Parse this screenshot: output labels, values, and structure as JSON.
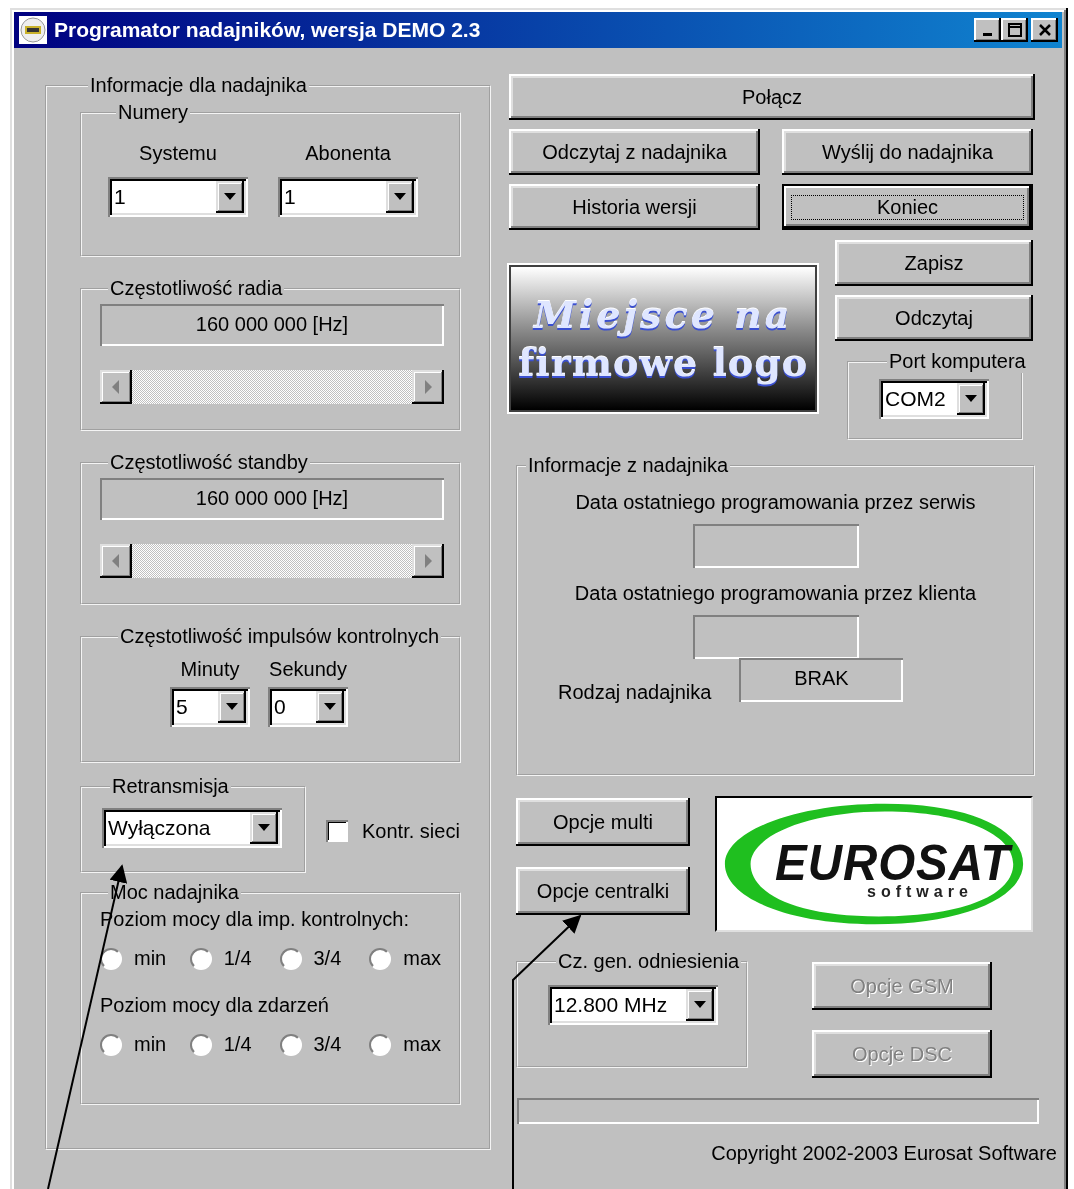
{
  "window": {
    "title": "Programator nadajników, wersja DEMO 2.3"
  },
  "transmitter_info": {
    "title": "Informacje dla nadajnika",
    "numbers": {
      "title": "Numery",
      "fields": [
        {
          "label": "Systemu",
          "value": "1"
        },
        {
          "label": "Abonenta",
          "value": "1"
        }
      ]
    },
    "radio_frequency": {
      "title": "Częstotliwość radia",
      "value": "160 000 000 [Hz]"
    },
    "standby_frequency": {
      "title": "Częstotliwość standby",
      "value": "160 000 000 [Hz]"
    },
    "control_pulses": {
      "title": "Częstotliwość impulsów kontrolnych",
      "fields": [
        {
          "label": "Minuty",
          "value": "5"
        },
        {
          "label": "Sekundy",
          "value": "0"
        }
      ]
    },
    "retransmission": {
      "title": "Retransmisja",
      "value": "Wyłączona"
    },
    "network_control": {
      "label": "Kontr. sieci",
      "checked": false
    },
    "power": {
      "title": "Moc nadajnika",
      "groups": [
        {
          "label": "Poziom mocy dla imp. kontrolnych:",
          "options": [
            {
              "label": "min",
              "selected": false
            },
            {
              "label": "1/4",
              "selected": false
            },
            {
              "label": "3/4",
              "selected": false
            },
            {
              "label": "max",
              "selected": false
            }
          ]
        },
        {
          "label": "Poziom mocy dla zdarzeń",
          "options": [
            {
              "label": "min",
              "selected": false
            },
            {
              "label": "1/4",
              "selected": false
            },
            {
              "label": "3/4",
              "selected": false
            },
            {
              "label": "max",
              "selected": false
            }
          ]
        }
      ]
    }
  },
  "top_buttons": [
    [
      {
        "label": "Połącz",
        "disabled": false,
        "focused": false
      }
    ],
    [
      {
        "label": "Odczytaj z nadajnika",
        "disabled": false,
        "focused": false
      },
      {
        "label": "Wyślij do nadajnika",
        "disabled": false,
        "focused": false
      }
    ],
    [
      {
        "label": "Historia wersji",
        "disabled": false,
        "focused": false
      },
      {
        "label": "Koniec",
        "disabled": false,
        "focused": true
      }
    ]
  ],
  "logo_placeholder": {
    "lines": [
      "Miejsce na",
      "firmowe logo"
    ]
  },
  "file_buttons": [
    {
      "label": "Zapisz",
      "disabled": false,
      "focused": false
    },
    {
      "label": "Odczytaj",
      "disabled": false,
      "focused": false
    }
  ],
  "port": {
    "title": "Port komputera",
    "value": "COM2"
  },
  "device_info": {
    "title": "Informacje z nadajnika",
    "fields": [
      {
        "kind": "stacked",
        "label": "Data ostatniego programowania przez serwis"
      },
      {
        "kind": "stacked",
        "label": "Data ostatniego programowania przez klienta"
      },
      {
        "kind": "inline",
        "label": "Rodzaj nadajnika",
        "value": "BRAK"
      }
    ]
  },
  "option_buttons": [
    {
      "label": "Opcje multi",
      "disabled": false,
      "focused": false
    },
    {
      "label": "Opcje centralki",
      "disabled": false,
      "focused": false
    }
  ],
  "brand_logo": {
    "name": "EUROSAT",
    "tagline": "software"
  },
  "reference_generator": {
    "title": "Cz. gen. odniesienia",
    "value": "12.800 MHz"
  },
  "extra_buttons": [
    {
      "label": "Opcje GSM",
      "disabled": true,
      "focused": false
    },
    {
      "label": "Opcje DSC",
      "disabled": true,
      "focused": false
    }
  ],
  "progress": {
    "level": 0
  },
  "copyright": "Copyright 2002-2003 Eurosat Software"
}
